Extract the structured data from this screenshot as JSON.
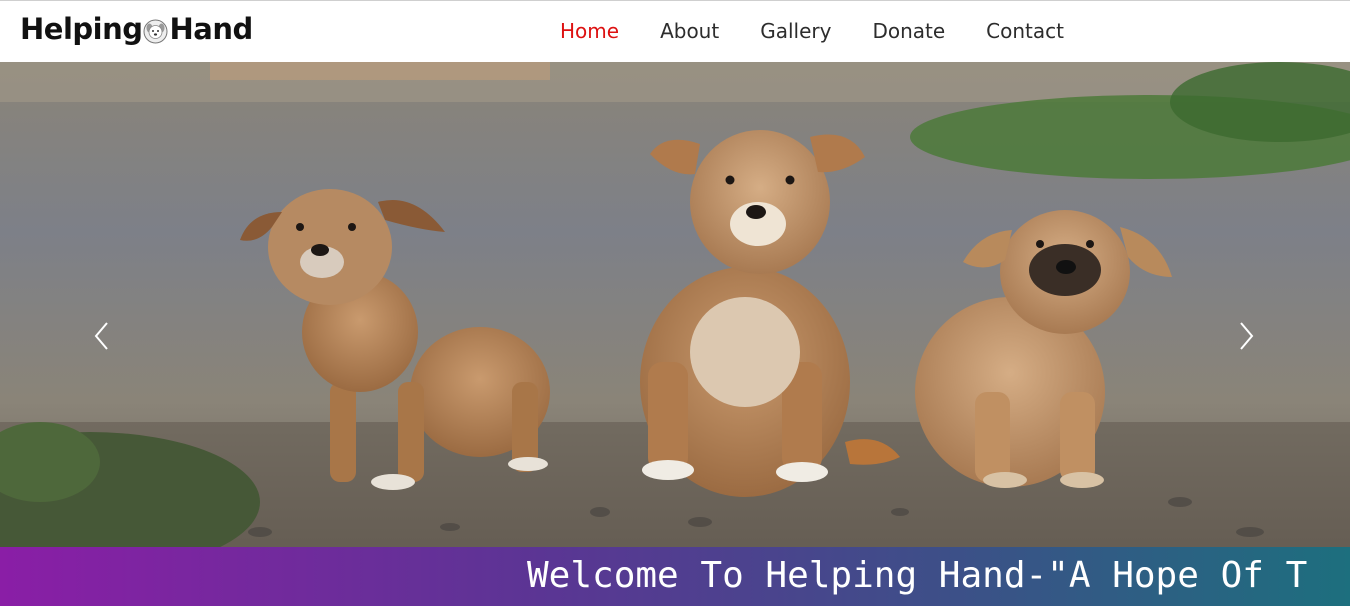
{
  "brand": {
    "part1": "Helping",
    "part2": "Hand",
    "logo_icon": "dog-face-icon"
  },
  "nav": {
    "items": [
      "Home",
      "About",
      "Gallery",
      "Donate",
      "Contact"
    ],
    "active": "Home"
  },
  "carousel": {
    "image": "three-puppies-photo",
    "prev_icon": "chevron-left-icon",
    "next_icon": "chevron-right-icon"
  },
  "ticker": {
    "text": "Welcome To Helping Hand-\"A Hope Of T"
  },
  "colors": {
    "active_nav": "#dd1111",
    "ticker_start": "#8a1ea6",
    "ticker_end": "#1d6f7e"
  }
}
